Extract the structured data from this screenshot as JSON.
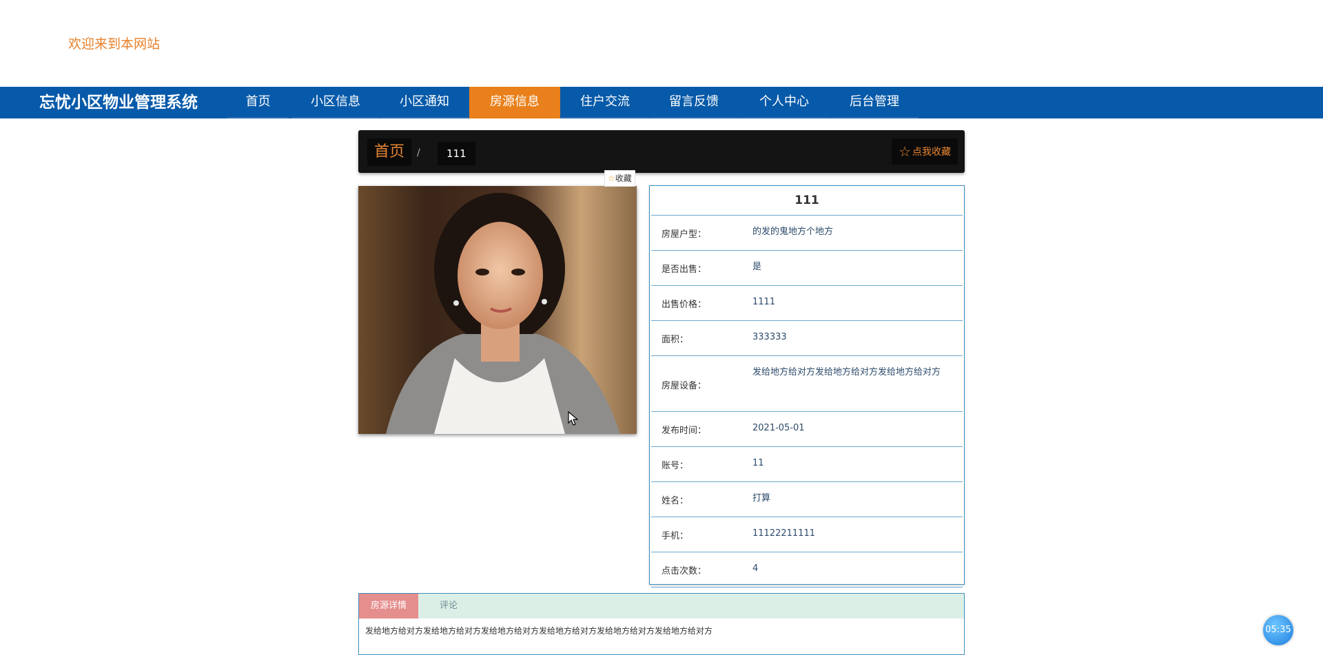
{
  "header": {
    "welcome": "欢迎来到本网站"
  },
  "nav": {
    "brand": "忘忧小区物业管理系统",
    "items": [
      {
        "label": "首页"
      },
      {
        "label": "小区信息"
      },
      {
        "label": "小区通知"
      },
      {
        "label": "房源信息",
        "active": true
      },
      {
        "label": "住户交流"
      },
      {
        "label": "留言反馈"
      },
      {
        "label": "个人中心"
      },
      {
        "label": "后台管理"
      }
    ]
  },
  "breadcrumb": {
    "home": "首页",
    "separator": "/",
    "current": "111"
  },
  "favorite": {
    "top_label": "点我收藏",
    "small_label": "收藏"
  },
  "detail": {
    "title": "111",
    "rows": [
      {
        "label": "房屋户型：",
        "value": "的发的鬼地方个地方"
      },
      {
        "label": "是否出售：",
        "value": "是"
      },
      {
        "label": "出售价格：",
        "value": "1111"
      },
      {
        "label": "面积：",
        "value": "333333"
      },
      {
        "label": "房屋设备：",
        "value": "发给地方给对方发给地方给对方发给地方给对方"
      },
      {
        "label": "发布时间：",
        "value": "2021-05-01"
      },
      {
        "label": "账号：",
        "value": "11"
      },
      {
        "label": "姓名：",
        "value": "打算"
      },
      {
        "label": "手机：",
        "value": "11122211111"
      },
      {
        "label": "点击次数：",
        "value": "4"
      }
    ]
  },
  "tabs": {
    "items": [
      {
        "label": "房源详情"
      },
      {
        "label": "评论"
      }
    ],
    "content": "发给地方给对方发给地方给对方发给地方给对方发给地方给对方发给地方给对方发给地方给对方"
  },
  "clock": {
    "time": "05:35"
  },
  "colors": {
    "nav_bg": "#075aa9",
    "nav_active": "#e9801b",
    "accent_orange": "#e98532",
    "border_blue": "#3d8fc0"
  }
}
